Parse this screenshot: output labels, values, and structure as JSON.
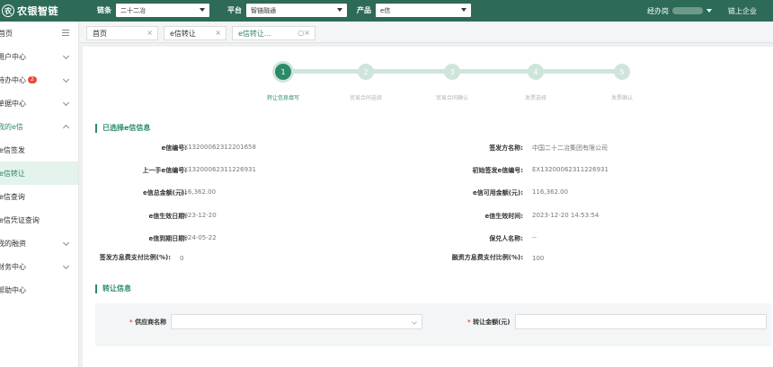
{
  "brand": {
    "logo_char": "农",
    "name": "农银智链"
  },
  "filters": [
    {
      "label": "链条",
      "value": "二十二冶"
    },
    {
      "label": "平台",
      "value": "智链融通"
    },
    {
      "label": "产品",
      "value": "e信"
    }
  ],
  "user": {
    "role": "经办岗",
    "company_label": "链上企业"
  },
  "sidebar": {
    "items": [
      {
        "label": "首页",
        "icon": "menu-icon"
      },
      {
        "label": "用户中心",
        "icon": "chevron-down-icon"
      },
      {
        "label": "待办中心",
        "badge": "2",
        "icon": "chevron-down-icon"
      },
      {
        "label": "单据中心",
        "icon": "chevron-down-icon"
      },
      {
        "label": "我的e信",
        "icon": "chevron-up-icon"
      },
      {
        "label": "e信签发"
      },
      {
        "label": "e信转让"
      },
      {
        "label": "e信查询"
      },
      {
        "label": "e信凭证查询"
      },
      {
        "label": "我的融资",
        "icon": "chevron-down-icon"
      },
      {
        "label": "财务中心",
        "icon": "chevron-down-icon"
      },
      {
        "label": "帮助中心"
      }
    ]
  },
  "tabs": [
    {
      "label": "首页"
    },
    {
      "label": "e信转让"
    },
    {
      "label": "e信转让..."
    }
  ],
  "steps": [
    {
      "num": "1",
      "label": "转让信息填写"
    },
    {
      "num": "2",
      "label": "贸易合同选择"
    },
    {
      "num": "3",
      "label": "贸易合同确认"
    },
    {
      "num": "4",
      "label": "发票选择"
    },
    {
      "num": "5",
      "label": "发票确认"
    }
  ],
  "selected_section": {
    "title": "已选择e信信息",
    "left_fields": [
      {
        "label": "e信编号:",
        "value": "EX13200062312201658"
      },
      {
        "label": "上一手e信编号:",
        "value": "EX13200062311226931"
      },
      {
        "label": "e信总金额(元):",
        "value": "116,362.00"
      },
      {
        "label": "e信生效日期:",
        "value": "2023-12-20"
      },
      {
        "label": "e信到期日期:",
        "value": "2024-05-22"
      },
      {
        "label": "签发方息费支付比例(%):",
        "value": "0"
      }
    ],
    "right_fields": [
      {
        "label": "签发方名称:",
        "value": "中国二十二冶集团有限公司"
      },
      {
        "label": "初始签发e信编号:",
        "value": "EX13200062311226931"
      },
      {
        "label": "e信可用金额(元):",
        "value": "116,362.00"
      },
      {
        "label": "e信生效时间:",
        "value": "2023-12-20 14:53:54"
      },
      {
        "label": "保兑人名称:",
        "value": "--"
      },
      {
        "label": "融资方息费支付比例(%):",
        "value": "100"
      }
    ]
  },
  "transfer_section": {
    "title": "转让信息",
    "supplier_label": "供应商名称",
    "amount_label": "转让金额(元)",
    "required_mark": "*"
  },
  "colors": {
    "brand": "#2d6b58",
    "accent": "#2d8a66",
    "step_inactive": "#cfe5dc"
  }
}
